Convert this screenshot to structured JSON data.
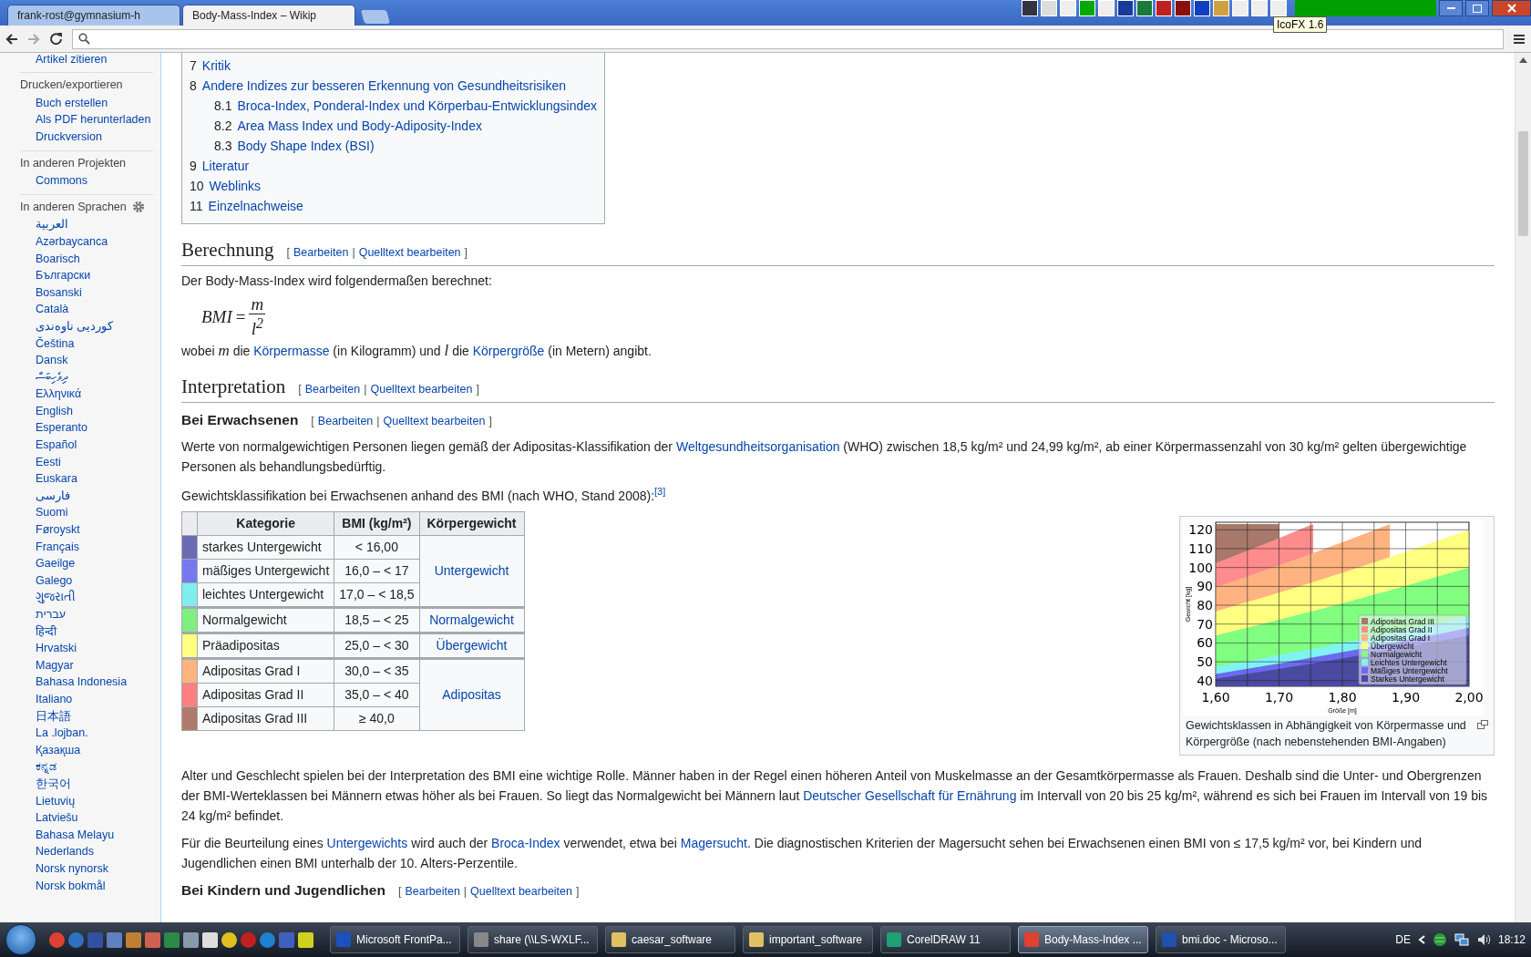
{
  "browser": {
    "tabs": [
      {
        "title": "frank-rost@gymnasium-h",
        "selected": false
      },
      {
        "title": "Body-Mass-Index – Wikip",
        "selected": true
      }
    ],
    "tooltip": "IcoFX 1.6"
  },
  "sidebar": {
    "groups": [
      {
        "items": [
          "Artikel zitieren"
        ]
      },
      {
        "heading": "Drucken/exportieren",
        "items": [
          "Buch erstellen",
          "Als PDF herunterladen",
          "Druckversion"
        ]
      },
      {
        "heading": "In anderen Projekten",
        "items": [
          "Commons"
        ]
      },
      {
        "heading": "In anderen Sprachen",
        "settings": true,
        "items": [
          "العربية",
          "Azərbaycanca",
          "Boarisch",
          "Български",
          "Bosanski",
          "Català",
          "کوردیی ناوەندی",
          "Čeština",
          "Dansk",
          "ދިވެހިބަސް",
          "Ελληνικά",
          "English",
          "Esperanto",
          "Español",
          "Eesti",
          "Euskara",
          "فارسی",
          "Suomi",
          "Føroyskt",
          "Français",
          "Gaeilge",
          "Galego",
          "ગુજરાતી",
          "עברית",
          "हिन्दी",
          "Hrvatski",
          "Magyar",
          "Bahasa Indonesia",
          "Italiano",
          "日本語",
          "La .lojban.",
          "Қазақша",
          "ಕನ್ನಡ",
          "한국어",
          "Lietuvių",
          "Latviešu",
          "Bahasa Melayu",
          "Nederlands",
          "Norsk nynorsk",
          "Norsk bokmål"
        ]
      }
    ]
  },
  "toc": [
    {
      "number": "7",
      "title": "Kritik"
    },
    {
      "number": "8",
      "title": "Andere Indizes zur besseren Erkennung von Gesundheitsrisiken",
      "children": [
        {
          "number": "8.1",
          "title": "Broca-Index, Ponderal-Index und Körperbau-Entwicklungsindex"
        },
        {
          "number": "8.2",
          "title": "Area Mass Index und Body-Adiposity-Index"
        },
        {
          "number": "8.3",
          "title": "Body Shape Index (BSI)"
        }
      ]
    },
    {
      "number": "9",
      "title": "Literatur"
    },
    {
      "number": "10",
      "title": "Weblinks"
    },
    {
      "number": "11",
      "title": "Einzelnachweise"
    }
  ],
  "blocks": [
    {
      "kind": "h2",
      "title": "Berechnung",
      "edit": {
        "open": "[",
        "links": [
          "Bearbeiten",
          "Quelltext bearbeiten"
        ],
        "separator": "|",
        "close": "]"
      }
    },
    {
      "kind": "paragraph",
      "parts": [
        {
          "kind": "text",
          "text": "Der Body-Mass-Index wird folgendermaßen berechnet:"
        }
      ]
    },
    {
      "kind": "formula",
      "lhs": "BMI",
      "operator": "=",
      "numerator": "m",
      "denominator": "l$^{2}$"
    },
    {
      "kind": "paragraph",
      "parts": [
        {
          "kind": "text",
          "text": "wobei "
        },
        {
          "kind": "math",
          "text": "m"
        },
        {
          "kind": "text",
          "text": " die "
        },
        {
          "kind": "link",
          "text": "Körpermasse"
        },
        {
          "kind": "text",
          "text": " (in Kilogramm) und "
        },
        {
          "kind": "math",
          "text": "l"
        },
        {
          "kind": "text",
          "text": " die "
        },
        {
          "kind": "link",
          "text": "Körpergröße"
        },
        {
          "kind": "text",
          "text": " (in Metern) angibt."
        }
      ]
    },
    {
      "kind": "h2",
      "title": "Interpretation",
      "edit": {
        "open": "[",
        "links": [
          "Bearbeiten",
          "Quelltext bearbeiten"
        ],
        "separator": "|",
        "close": "]"
      }
    },
    {
      "kind": "h3",
      "title": "Bei Erwachsenen",
      "edit": {
        "open": "[",
        "links": [
          "Bearbeiten",
          "Quelltext bearbeiten"
        ],
        "separator": "|",
        "close": "]"
      }
    },
    {
      "kind": "paragraph",
      "parts": [
        {
          "kind": "text",
          "text": "Werte von normalgewichtigen Personen liegen gemäß der Adipositas-Klassifikation der "
        },
        {
          "kind": "link",
          "text": "Weltgesundheitsorganisation"
        },
        {
          "kind": "text",
          "text": " (WHO) zwischen 18,5 kg/m² und 24,99 kg/m², ab einer Körpermassenzahl von 30 kg/m² gelten übergewichtige Personen als behandlungsbedürftig."
        }
      ]
    },
    {
      "kind": "paragraph",
      "parts": [
        {
          "kind": "text",
          "text": "Gewichtsklassifikation bei Erwachsenen anhand des BMI (nach WHO, Stand 2008):"
        },
        {
          "kind": "ref",
          "text": "[3]"
        }
      ]
    },
    {
      "kind": "classification"
    },
    {
      "kind": "paragraph",
      "parts": [
        {
          "kind": "text",
          "text": "Alter und Geschlecht spielen bei der Interpretation des BMI eine wichtige Rolle. Männer haben in der Regel einen höheren Anteil von Muskelmasse an der Gesamtkörpermasse als Frauen. Deshalb sind die Unter- und Obergrenzen der BMI-Werteklassen bei Männern etwas höher als bei Frauen. So liegt das Normalgewicht bei Männern laut "
        },
        {
          "kind": "link",
          "text": "Deutscher Gesellschaft für Ernährung"
        },
        {
          "kind": "text",
          "text": " im Intervall von 20 bis 25 kg/m², während es sich bei Frauen im Intervall von 19 bis 24 kg/m² befindet."
        }
      ]
    },
    {
      "kind": "paragraph",
      "parts": [
        {
          "kind": "text",
          "text": "Für die Beurteilung eines "
        },
        {
          "kind": "link",
          "text": "Untergewichts"
        },
        {
          "kind": "text",
          "text": " wird auch der "
        },
        {
          "kind": "link",
          "text": "Broca-Index"
        },
        {
          "kind": "text",
          "text": " verwendet, etwa bei "
        },
        {
          "kind": "link",
          "text": "Magersucht"
        },
        {
          "kind": "text",
          "text": ". Die diagnostischen Kriterien der Magersucht sehen bei Erwachsenen einen BMI von ≤ 17,5 kg/m² vor, bei Kindern und Jugendlichen einen BMI unterhalb der 10. Alters-Perzentile."
        }
      ]
    },
    {
      "kind": "h3",
      "title": "Bei Kindern und Jugendlichen",
      "edit": {
        "open": "[",
        "links": [
          "Bearbeiten",
          "Quelltext bearbeiten"
        ],
        "separator": "|",
        "close": "]"
      }
    }
  ],
  "table": {
    "columns": [
      "Kategorie",
      "BMI (kg/m²)",
      "Körpergewicht"
    ],
    "groups": [
      {
        "weight": "Untergewicht",
        "rows": [
          {
            "color": "#6b6bb5",
            "category": "starkes Untergewicht",
            "bmi": "< 16,00"
          },
          {
            "color": "#7878ee",
            "category": "mäßiges Untergewicht",
            "bmi": "16,0 – < 17"
          },
          {
            "color": "#80eeee",
            "category": "leichtes Untergewicht",
            "bmi": "17,0 – < 18,5"
          }
        ]
      },
      {
        "weight": "Normalgewicht",
        "rows": [
          {
            "color": "#80ee80",
            "category": "Normalgewicht",
            "bmi": "18,5 – < 25"
          }
        ]
      },
      {
        "weight": "Übergewicht",
        "rows": [
          {
            "color": "#ffff80",
            "category": "Präadipositas",
            "bmi": "25,0 – < 30"
          }
        ]
      },
      {
        "weight": "Adipositas",
        "rows": [
          {
            "color": "#ffb380",
            "category": "Adipositas Grad I",
            "bmi": "30,0 – < 35"
          },
          {
            "color": "#ff8080",
            "category": "Adipositas Grad II",
            "bmi": "35,0 – < 40"
          },
          {
            "color": "#b07a6a",
            "category": "Adipositas Grad III",
            "bmi": "≥ 40,0"
          }
        ]
      }
    ]
  },
  "figure": {
    "caption": "Gewichtsklassen in Abhängigkeit von Körpermasse und Körpergröße (nach nebenstehenden BMI-Angaben)",
    "chart_data": {
      "type": "area",
      "grid": true,
      "xlabel": "Größe [m]",
      "ylabel": "Gewicht [kg]",
      "legend": true,
      "x": [
        1.6,
        1.65,
        1.7,
        1.75,
        1.754,
        1.8,
        1.85,
        1.875,
        1.9,
        1.95,
        2.0
      ],
      "xlim": [
        1.6,
        2.0
      ],
      "ylim": [
        37,
        124
      ],
      "xticks": [
        {
          "value": 1.6,
          "label": "1,60"
        },
        {
          "value": 1.7,
          "label": "1,70"
        },
        {
          "value": 1.8,
          "label": "1,80"
        },
        {
          "value": 1.9,
          "label": "1,90"
        },
        {
          "value": 2.0,
          "label": "2,00"
        }
      ],
      "yticks": [
        40,
        50,
        60,
        70,
        80,
        90,
        100,
        110,
        120
      ],
      "series": [
        {
          "name": "Starkes Untergewicht",
          "color": "#4a4aa0",
          "values": [
            41.0,
            43.6,
            46.2,
            49.0,
            49.2,
            51.8,
            54.8,
            56.3,
            57.8,
            60.8,
            64.0
          ]
        },
        {
          "name": "Mäßiges Untergewicht",
          "color": "#6b6bee",
          "values": [
            43.5,
            46.3,
            49.1,
            52.1,
            52.3,
            55.1,
            58.2,
            59.8,
            61.4,
            64.6,
            68.0
          ]
        },
        {
          "name": "Leichtes Untergewicht",
          "color": "#80f2f2",
          "values": [
            47.4,
            50.4,
            53.5,
            56.7,
            56.9,
            59.9,
            63.3,
            65.0,
            66.8,
            70.3,
            74.0
          ]
        },
        {
          "name": "Normalgewicht",
          "color": "#80ff80",
          "values": [
            64.0,
            68.1,
            72.3,
            76.6,
            76.9,
            81.0,
            85.6,
            87.9,
            90.3,
            95.1,
            100.0
          ]
        },
        {
          "name": "Übergewicht",
          "color": "#ffff80",
          "values": [
            76.8,
            81.7,
            86.7,
            91.9,
            92.3,
            97.2,
            102.7,
            105.5,
            108.3,
            114.1,
            120.0
          ]
        },
        {
          "name": "Adipositas Grad I",
          "color": "#ffb380",
          "values": [
            89.6,
            95.3,
            101.2,
            107.2,
            107.7,
            113.4,
            119.8,
            123.0,
            null,
            null,
            null
          ]
        },
        {
          "name": "Adipositas Grad II",
          "color": "#ff8c8c",
          "values": [
            102.4,
            108.9,
            115.6,
            122.5,
            123.0,
            null,
            null,
            null,
            null,
            null,
            null
          ]
        },
        {
          "name": "Adipositas Grad III",
          "color": "#a8786a",
          "values": [
            123,
            123,
            123,
            null,
            null,
            null,
            null,
            null,
            null,
            null,
            null
          ]
        }
      ]
    }
  },
  "taskbar": {
    "tasks": [
      {
        "label": "Microsoft FrontPa...",
        "selected": false
      },
      {
        "label": "share (\\\\LS-WXLF...",
        "selected": false
      },
      {
        "label": "caesar_software",
        "selected": false
      },
      {
        "label": "important_software",
        "selected": false
      },
      {
        "label": "CorelDRAW 11",
        "selected": false
      },
      {
        "label": "Body-Mass-Index ...",
        "selected": true
      },
      {
        "label": "bmi.doc - Microso...",
        "selected": false
      }
    ],
    "language": "DE",
    "clock": "18:12"
  }
}
